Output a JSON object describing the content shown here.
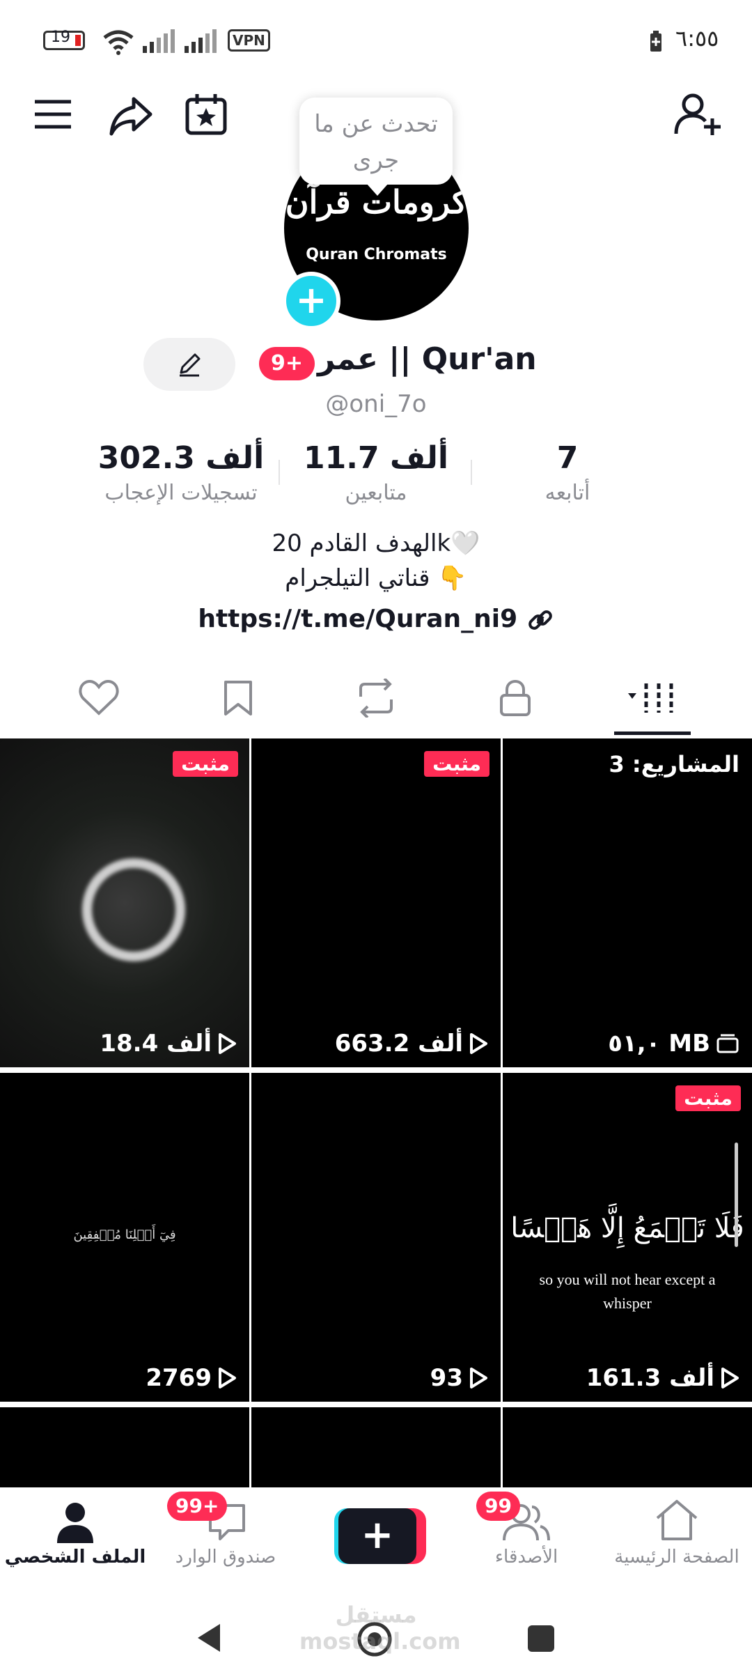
{
  "status": {
    "time": "٦:٥٥",
    "battery": "19",
    "vpn": "VPN"
  },
  "tooltip": {
    "line1": "تحدث عن ما",
    "line2": "جرى"
  },
  "avatar": {
    "title_ar": "كرومات قرآن",
    "title_en": "Quran Chromats"
  },
  "profile": {
    "name_badge": "9+",
    "display_name": "عمر || Qur'an",
    "username": "@oni_7o"
  },
  "stats": [
    {
      "value": "7",
      "label": "أتابعه"
    },
    {
      "value": "11.7 ألف",
      "label": "متابعين"
    },
    {
      "value": "302.3 ألف",
      "label": "تسجيلات الإعجاب"
    }
  ],
  "bio": {
    "line1": "الهدف القادم 20k🤍",
    "line2": "قناتي التيلجرام 👇",
    "link": "https://t.me/Quran_ni9"
  },
  "tabs": [
    "videos",
    "private",
    "reposts",
    "favorites",
    "liked"
  ],
  "grid": {
    "pinned_label": "مثبت",
    "drafts_label": "المشاريع: 3",
    "drafts_size": "٥١,٠ MB",
    "items": [
      {
        "views": "18.4 ألف"
      },
      {
        "views": "663.2 ألف"
      },
      {
        "views": "2769"
      },
      {
        "views": "93"
      },
      {
        "views": "161.3 ألف",
        "verse": "فَلَا تَسۡمَعُ إِلَّا هَمۡسًا",
        "caption": "so you will not hear except a whisper"
      }
    ],
    "small_verse": "فِيٓ أَهۡلِنَا مُشۡفِقِينَ"
  },
  "bottom_nav": {
    "profile": "الملف الشخصي",
    "inbox": "صندوق الوارد",
    "inbox_badge": "99+",
    "friends": "الأصدقاء",
    "friends_badge": "99",
    "home": "الصفحة الرئيسية"
  },
  "watermark": "مستقل mostaql.com"
}
